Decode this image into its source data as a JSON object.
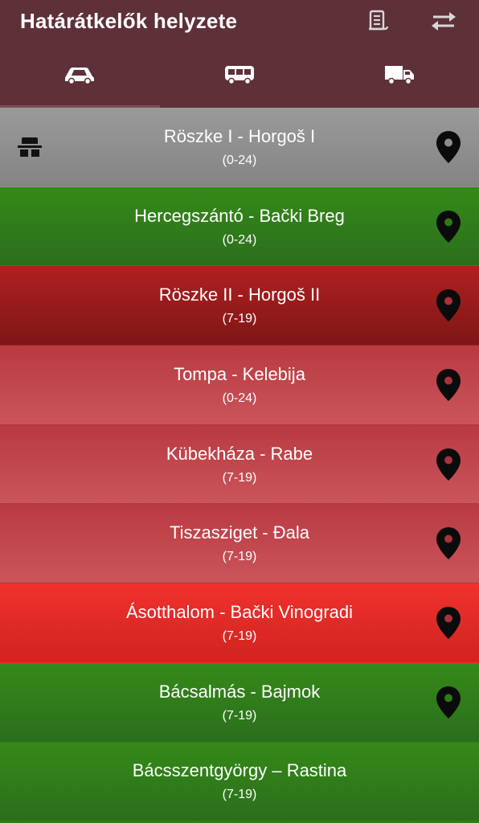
{
  "app": {
    "title": "Határátkelők helyzete",
    "actions": [
      {
        "name": "list-icon"
      },
      {
        "name": "swap-icon"
      }
    ],
    "tabs": [
      {
        "name": "car-icon",
        "active": true
      },
      {
        "name": "bus-icon",
        "active": false
      },
      {
        "name": "truck-icon",
        "active": false
      }
    ]
  },
  "colors": {
    "appbar": "#5e3038",
    "gray": "#8d8d8d",
    "green": "#2f7a17",
    "dark_red": "#9b1b1b",
    "light_red": "#c0444a",
    "bright_red": "#e02a28"
  },
  "crossings": [
    {
      "name": "Röszke I - Horgoš I",
      "hours": "(0-24)",
      "status": "gray",
      "highway": true,
      "pin": true
    },
    {
      "name": "Hercegszántó - Bački Breg",
      "hours": "(0-24)",
      "status": "green",
      "highway": false,
      "pin": true
    },
    {
      "name": "Röszke II - Horgoš II",
      "hours": "(7-19)",
      "status": "dark_red",
      "highway": false,
      "pin": true
    },
    {
      "name": "Tompa - Kelebija",
      "hours": "(0-24)",
      "status": "light_red",
      "highway": false,
      "pin": true
    },
    {
      "name": "Kübekháza - Rabe",
      "hours": "(7-19)",
      "status": "light_red",
      "highway": false,
      "pin": true
    },
    {
      "name": "Tiszasziget - Đala",
      "hours": "(7-19)",
      "status": "light_red",
      "highway": false,
      "pin": true
    },
    {
      "name": "Ásotthalom - Bački Vinogradi",
      "hours": "(7-19)",
      "status": "bright_red",
      "highway": false,
      "pin": true
    },
    {
      "name": "Bácsalmás - Bajmok",
      "hours": "(7-19)",
      "status": "green",
      "highway": false,
      "pin": true
    },
    {
      "name": "Bácsszentgyörgy – Rastina",
      "hours": "(7-19)",
      "status": "green",
      "highway": false,
      "pin": false
    }
  ]
}
